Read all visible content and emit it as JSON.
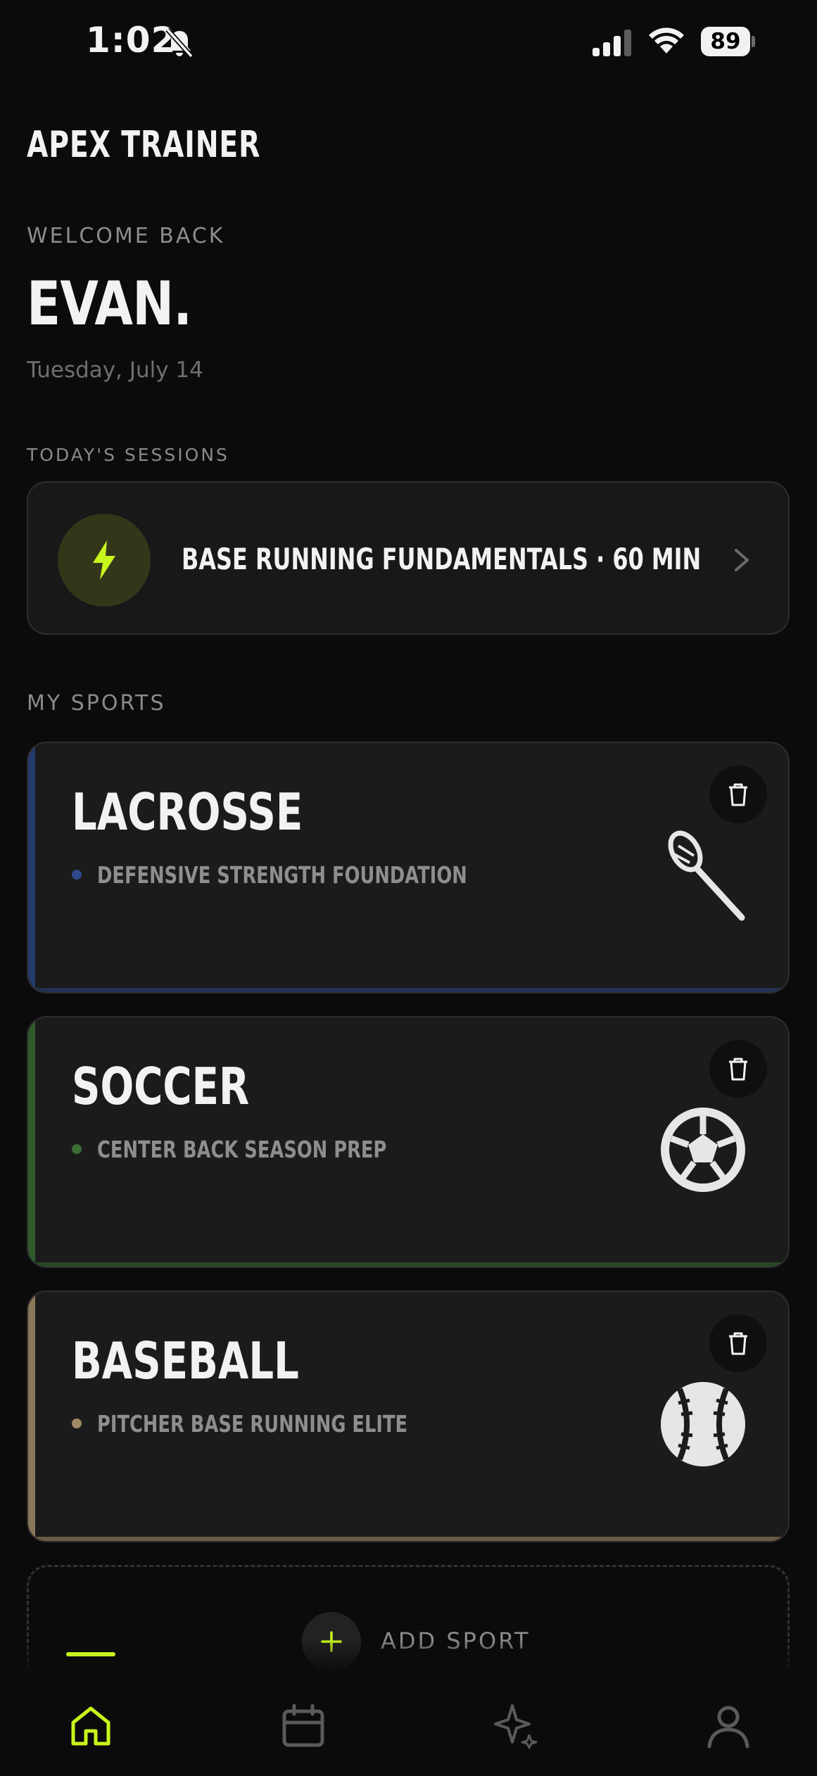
{
  "status_bar": {
    "time": "1:02",
    "battery": "89"
  },
  "app": {
    "title": "APEX TRAINER"
  },
  "header": {
    "welcome": "WELCOME BACK",
    "user_name": "EVAN.",
    "date": "Tuesday, July 14"
  },
  "sessions": {
    "label": "TODAY'S SESSIONS",
    "items": [
      {
        "title": "BASE RUNNING FUNDAMENTALS · 60 MIN",
        "icon": "lightning-icon"
      }
    ]
  },
  "sports": {
    "label": "MY SPORTS",
    "items": [
      {
        "name": "LACROSSE",
        "program": "DEFENSIVE STRENGTH FOUNDATION",
        "accent": "#253a6b",
        "icon": "lacrosse-stick-icon"
      },
      {
        "name": "SOCCER",
        "program": "CENTER BACK SEASON PREP",
        "accent": "#2f5a2a",
        "icon": "soccer-ball-icon"
      },
      {
        "name": "BASEBALL",
        "program": "PITCHER BASE RUNNING ELITE",
        "accent": "#8a7658",
        "icon": "baseball-icon"
      }
    ],
    "add_label": "ADD SPORT"
  },
  "tabbar": {
    "items": [
      {
        "name": "home",
        "icon": "home-icon",
        "active": true
      },
      {
        "name": "calendar",
        "icon": "calendar-icon",
        "active": false
      },
      {
        "name": "ai",
        "icon": "sparkle-icon",
        "active": false
      },
      {
        "name": "profile",
        "icon": "profile-icon",
        "active": false
      }
    ]
  },
  "colors": {
    "accent": "#c8f51c",
    "background": "#0b0b0c",
    "card": "#1b1b1c"
  }
}
